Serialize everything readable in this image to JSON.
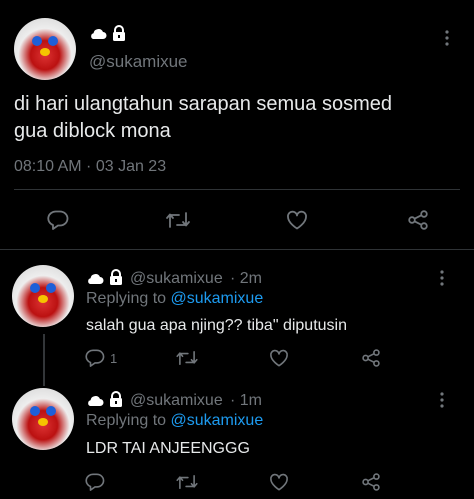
{
  "main_tweet": {
    "display_name_icons": [
      "cloud-icon",
      "lock-icon"
    ],
    "handle": "@sukamixue",
    "text_line1": "di hari ulangtahun sarapan semua sosmed",
    "text_line2": "gua diblock mona",
    "timestamp": "08:10 AM · 03 Jan 23"
  },
  "replies": [
    {
      "handle": "@sukamixue",
      "time": "· 2m",
      "replying_prefix": "Replying to",
      "replying_handle": "@sukamixue",
      "text": "salah gua apa njing?? tiba\" diputusin",
      "reply_count": "1"
    },
    {
      "handle": "@sukamixue",
      "time": "· 1m",
      "replying_prefix": "Replying to",
      "replying_handle": "@sukamixue",
      "text": "LDR TAI ANJEENGGG",
      "reply_count": ""
    }
  ],
  "colors": {
    "background": "#000000",
    "text": "#e7e9ea",
    "muted": "#71767b",
    "link": "#1d9bf0",
    "divider": "#2f3336"
  }
}
